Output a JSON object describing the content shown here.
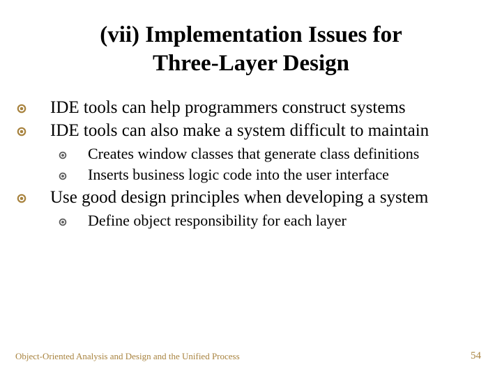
{
  "title_line1": "(vii) Implementation Issues for",
  "title_line2": "Three-Layer Design",
  "bullets": {
    "b1": "IDE tools can help programmers construct systems",
    "b2": "IDE tools can also make a system difficult to maintain",
    "b2_sub": {
      "s1": "Creates window classes that generate class definitions",
      "s2": "Inserts business logic code into the user interface"
    },
    "b3": "Use good design principles when developing a system",
    "b3_sub": {
      "s1": "Define object responsibility for each layer"
    }
  },
  "footer": {
    "left": "Object-Oriented Analysis and Design and the Unified Process",
    "right": "54"
  },
  "colors": {
    "bullet": "#a8833f",
    "footer": "#a8833f"
  }
}
